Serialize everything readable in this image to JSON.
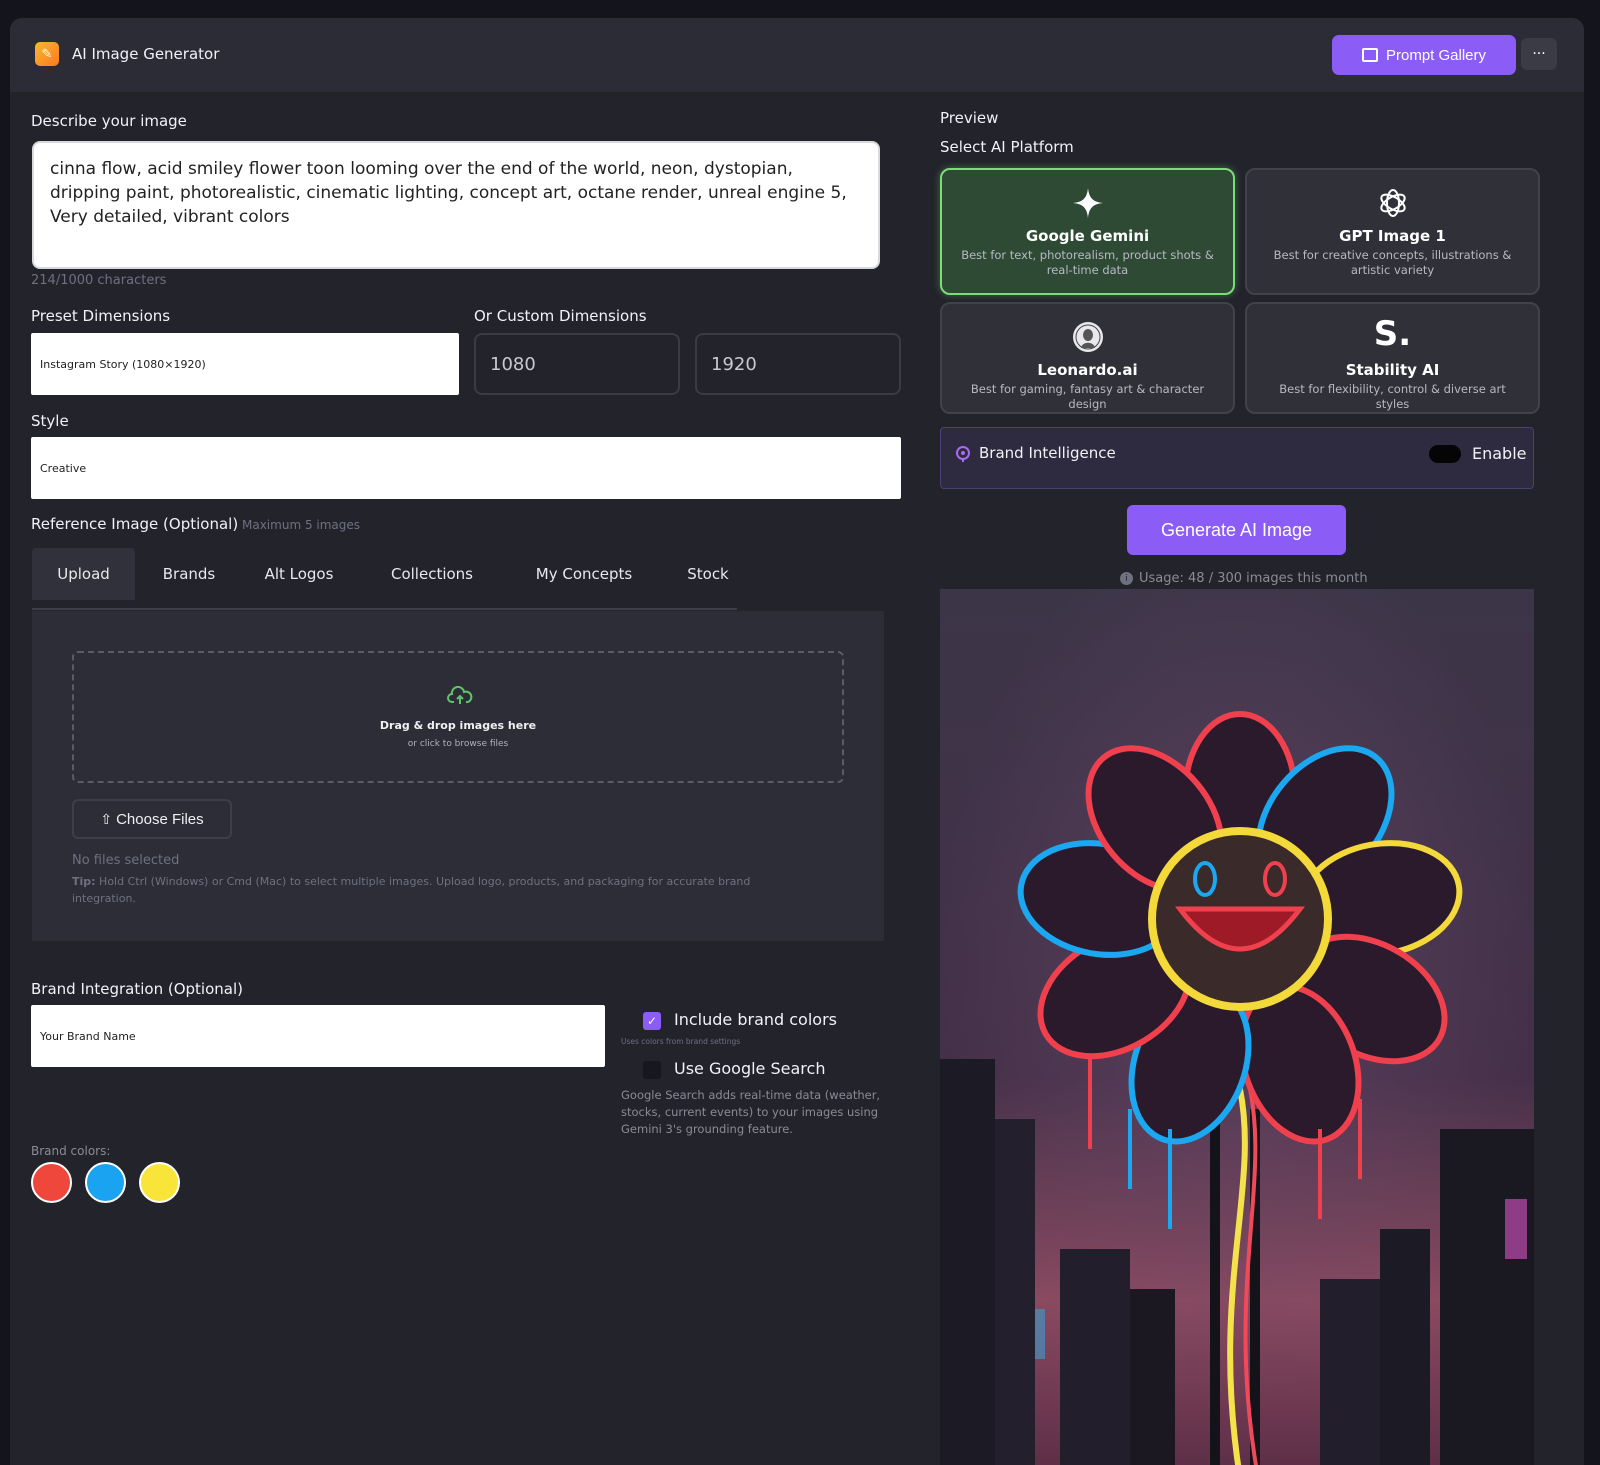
{
  "app": {
    "title": "AI Image Generator",
    "prompt_gallery": "Prompt Gallery",
    "more": "···"
  },
  "describe": {
    "label": "Describe your image",
    "value": "cinna flow, acid smiley flower toon looming over the end of the world, neon, dystopian, dripping paint, photorealistic, cinematic lighting, concept art, octane render, unreal engine 5, Very detailed, vibrant colors",
    "char_count": "214/1000 characters"
  },
  "dimensions": {
    "preset_label": "Preset Dimensions",
    "preset_value": "Instagram Story (1080×1920)",
    "custom_label": "Or Custom Dimensions",
    "width": "1080",
    "height": "1920"
  },
  "style": {
    "label": "Style",
    "value": "Creative"
  },
  "reference": {
    "label": "Reference Image (Optional)",
    "hint": "Maximum 5 images",
    "tabs": [
      "Upload",
      "Brands",
      "Alt Logos",
      "Collections",
      "My Concepts",
      "Stock"
    ],
    "active_tab": "Upload",
    "drop_title": "Drag & drop images here",
    "drop_sub": "or click to browse files",
    "choose_files": "Choose Files",
    "no_files": "No files selected",
    "tip_label": "Tip:",
    "tip_text": "Hold Ctrl (Windows) or Cmd (Mac) to select multiple images. Upload logo, products, and packaging for accurate brand integration."
  },
  "brand": {
    "label": "Brand Integration (Optional)",
    "name_placeholder": "Your Brand Name",
    "include_colors": "Include brand colors",
    "include_colors_checked": true,
    "include_colors_sub": "Uses colors from brand settings",
    "google_search": "Use Google Search",
    "google_search_checked": false,
    "google_search_desc": "Google Search adds real-time data (weather, stocks, current events) to your images using Gemini 3's grounding feature.",
    "colors_label": "Brand colors:",
    "colors": [
      "#f0473c",
      "#1aa3f0",
      "#f9e53a"
    ]
  },
  "preview": {
    "label": "Preview",
    "select_platform": "Select AI Platform"
  },
  "platforms": [
    {
      "name": "Google Gemini",
      "desc": "Best for text, photorealism, product shots & real-time data",
      "icon": "sparkle-icon",
      "active": true
    },
    {
      "name": "GPT Image 1",
      "desc": "Best for creative concepts, illustrations & artistic variety",
      "icon": "openai-icon",
      "active": false
    },
    {
      "name": "Leonardo.ai",
      "desc": "Best for gaming, fantasy art & character design",
      "icon": "leonardo-icon",
      "active": false
    },
    {
      "name": "Stability AI",
      "desc": "Best for flexibility, control & diverse art styles",
      "icon": "stability-icon",
      "active": false
    }
  ],
  "brand_intel": {
    "label": "Brand Intelligence",
    "toggle_label": "Enable",
    "enabled": false
  },
  "generate": {
    "label": "Generate AI Image",
    "usage": "Usage: 48 / 300 images this month"
  },
  "colors": {
    "accent": "#8b5cf6",
    "active_platform_border": "#7ddc7a",
    "background": "#22232b"
  }
}
